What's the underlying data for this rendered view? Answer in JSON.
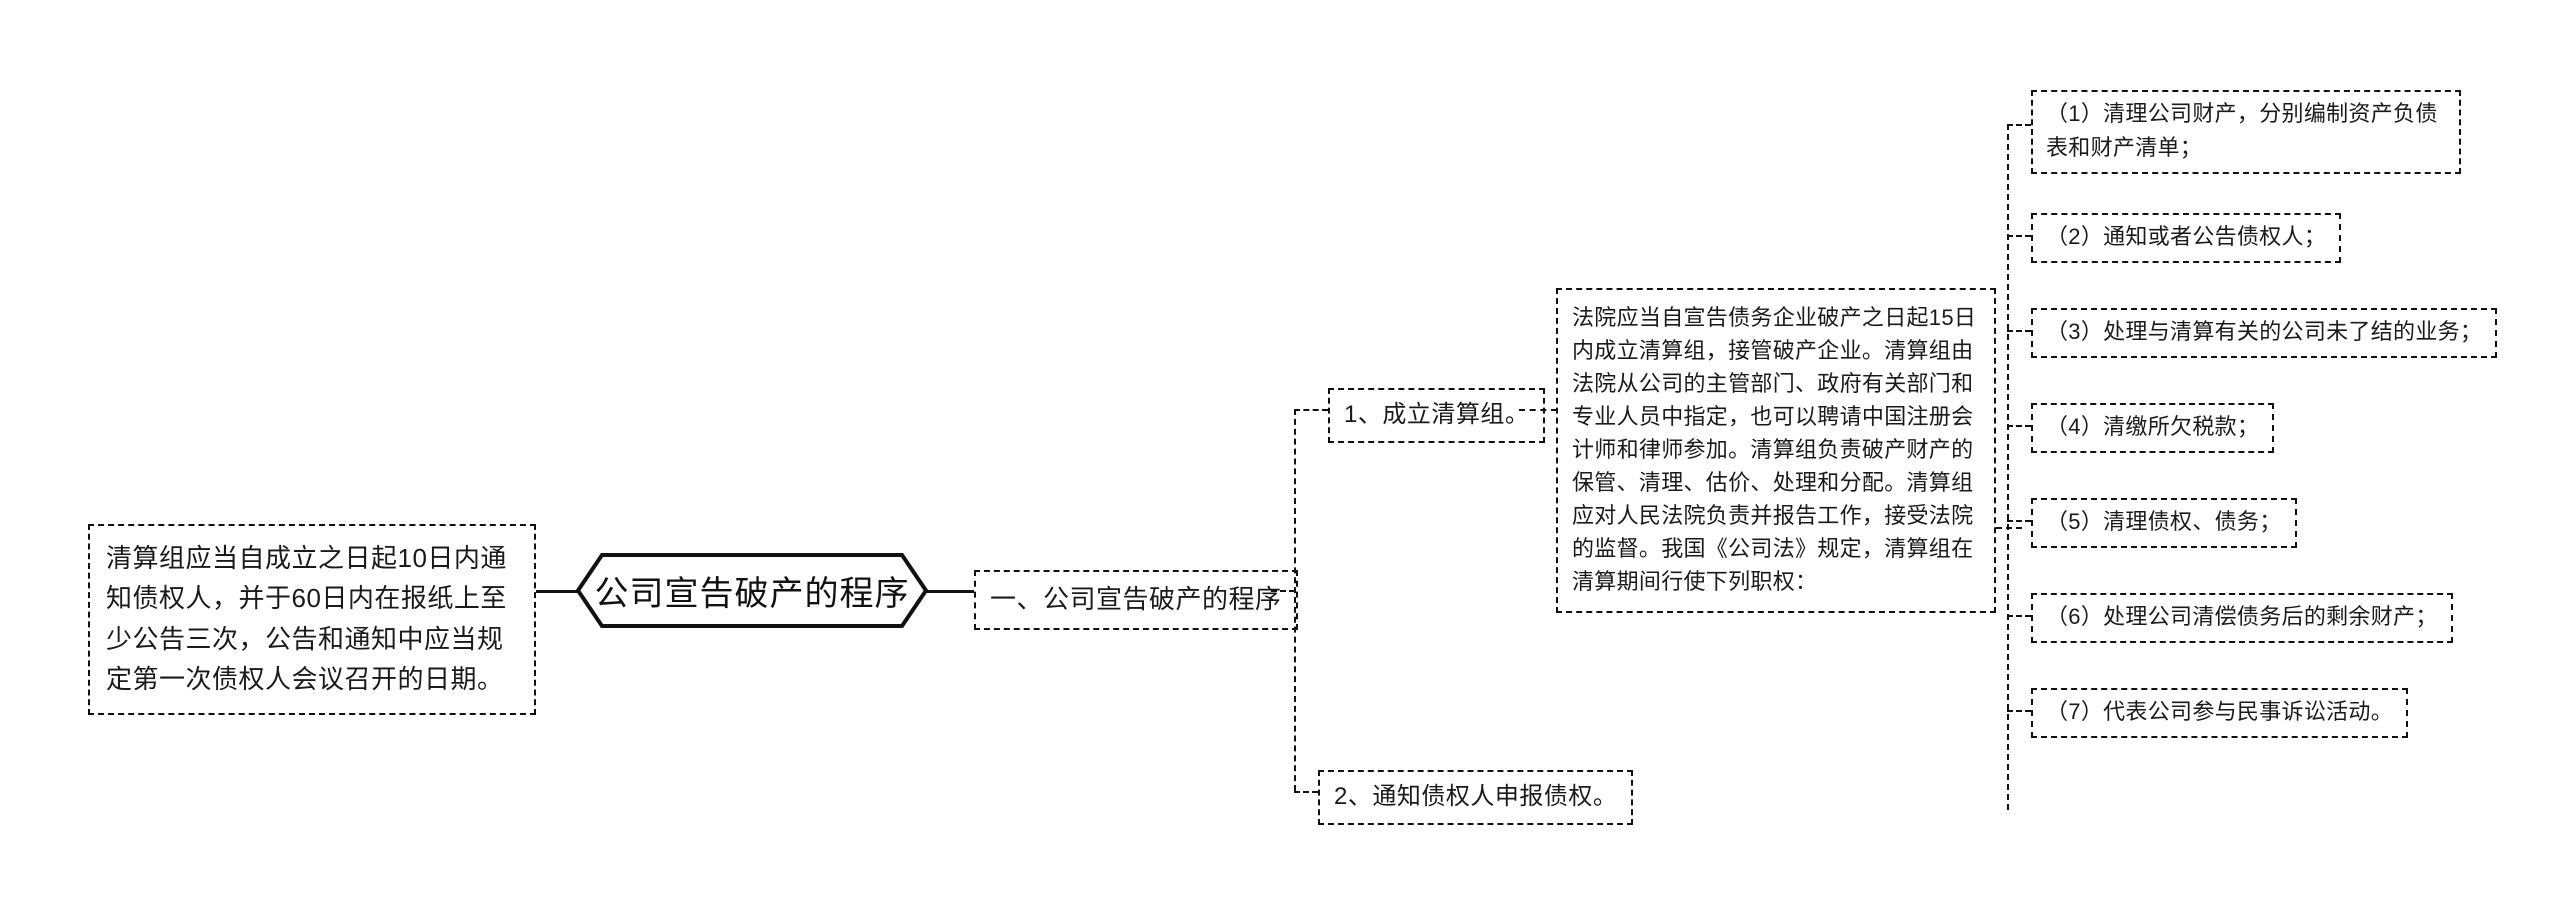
{
  "diagram": {
    "type": "mind-map",
    "orientation": "left-to-right",
    "background_color": "#ffffff",
    "line_color": "#111111",
    "text_color": "#1a1a1a"
  },
  "root": {
    "label": "公司宣告破产的程序",
    "shape": "hexagon"
  },
  "left_branch": {
    "detail": "清算组应当自成立之日起10日内通知债权人，并于60日内在报纸上至少公告三次，公告和通知中应当规定第一次债权人会议召开的日期。"
  },
  "right_branch": {
    "level1": {
      "label": "一、公司宣告破产的程序"
    },
    "level2": [
      {
        "label": "1、成立清算组。"
      },
      {
        "label": "2、通知债权人申报债权。"
      }
    ],
    "detail_paragraph": "法院应当自宣告债务企业破产之日起15日内成立清算组，接管破产企业。清算组由法院从公司的主管部门、政府有关部门和专业人员中指定，也可以聘请中国注册会计师和律师参加。清算组负责破产财产的保管、清理、估价、处理和分配。清算组应对人民法院负责并报告工作，接受法院的监督。我国《公司法》规定，清算组在清算期间行使下列职权：",
    "duties": [
      {
        "label": "（1）清理公司财产，分别编制资产负债表和财产清单；"
      },
      {
        "label": "（2）通知或者公告债权人；"
      },
      {
        "label": "（3）处理与清算有关的公司未了结的业务；"
      },
      {
        "label": "（4）清缴所欠税款；"
      },
      {
        "label": "（5）清理债权、债务；"
      },
      {
        "label": "（6）处理公司清偿债务后的剩余财产；"
      },
      {
        "label": "（7）代表公司参与民事诉讼活动。"
      }
    ]
  }
}
